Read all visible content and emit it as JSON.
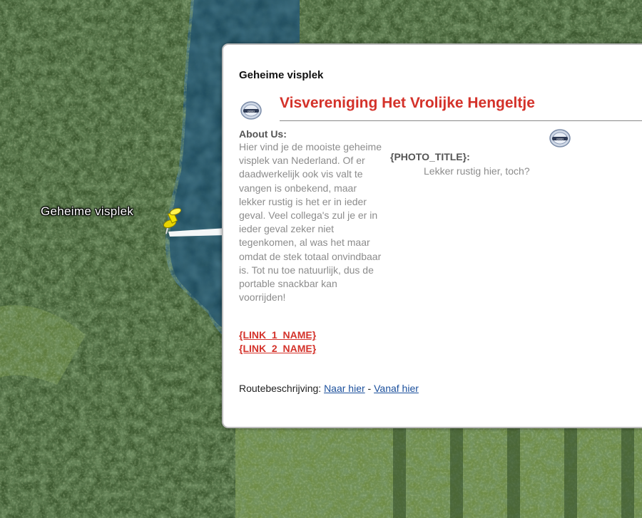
{
  "map": {
    "placemark_label": "Geheime visplek",
    "colors": {
      "water": "#1d4a5c",
      "forest": "#2d4626",
      "grass": "#6a8a40"
    }
  },
  "balloon": {
    "title": "Geheime visplek",
    "club_name": "Visvereniging Het Vrolijke Hengeltje",
    "about_heading": "About Us:",
    "about_text": "Hier vind je de mooiste geheime visplek van Nederland. Of er daadwerkelijk ook vis valt te vangen is onbekend, maar lekker rustig is het er in ieder geval. Veel collega's zul je er in ieder geval zeker niet tegenkomen, al was het maar omdat de stek totaal onvindbaar is. Tot nu toe natuurlijk, dus de portable snackbar kan voorrijden!",
    "links": [
      "{LINK_1_NAME}",
      "{LINK_2_NAME}"
    ],
    "photo_title": "{PHOTO_TITLE}:",
    "photo_caption": "Lekker rustig hier, toch?",
    "directions_label": "Routebeschrijving:",
    "directions_to": "Naar hier",
    "directions_sep": " - ",
    "directions_from": "Vanaf hier",
    "colors": {
      "accent": "#d4322a",
      "link": "#1a4f9c",
      "muted": "#8c8c8c"
    },
    "icons": [
      "club-logo-icon",
      "photo-logo-icon",
      "pushpin-icon"
    ]
  }
}
